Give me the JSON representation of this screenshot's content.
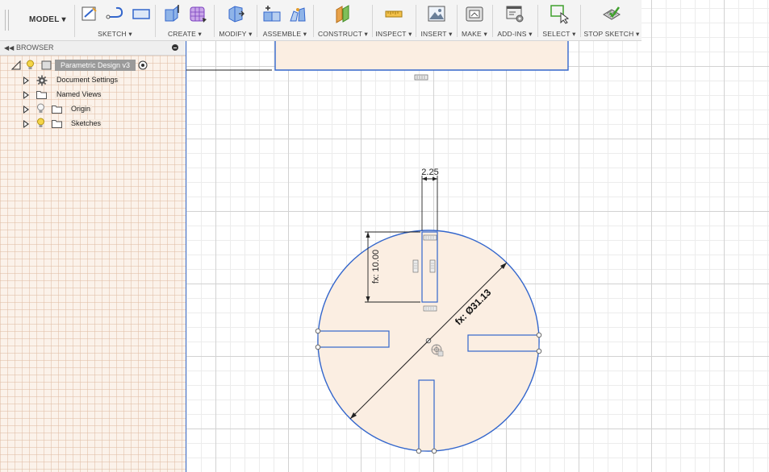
{
  "toolbar": {
    "workspace": "MODEL ▾",
    "groups": [
      {
        "id": "sketch",
        "label": "SKETCH ▾"
      },
      {
        "id": "create",
        "label": "CREATE ▾"
      },
      {
        "id": "modify",
        "label": "MODIFY ▾"
      },
      {
        "id": "assemble",
        "label": "ASSEMBLE ▾"
      },
      {
        "id": "construct",
        "label": "CONSTRUCT ▾"
      },
      {
        "id": "inspect",
        "label": "INSPECT ▾"
      },
      {
        "id": "insert",
        "label": "INSERT ▾"
      },
      {
        "id": "make",
        "label": "MAKE ▾"
      },
      {
        "id": "addins",
        "label": "ADD-INS ▾"
      },
      {
        "id": "select",
        "label": "SELECT ▾"
      },
      {
        "id": "stop",
        "label": "STOP SKETCH ▾"
      }
    ]
  },
  "browser": {
    "title": "BROWSER",
    "root": "Parametric Design v3",
    "items": [
      {
        "label": "Document Settings",
        "icon": "gear-icon"
      },
      {
        "label": "Named Views",
        "icon": "folder-icon"
      },
      {
        "label": "Origin",
        "icon": "folder-icon"
      },
      {
        "label": "Sketches",
        "icon": "folder-icon"
      }
    ]
  },
  "sketch": {
    "dimensions": {
      "slot_width": "2.25",
      "slot_length": "fx: 10.00",
      "diameter": "fx: Ø31.13"
    }
  },
  "colors": {
    "accent": "#3366cc",
    "sketch_fill": "#fbeee2",
    "browser_fill": "#fbf2ea"
  }
}
